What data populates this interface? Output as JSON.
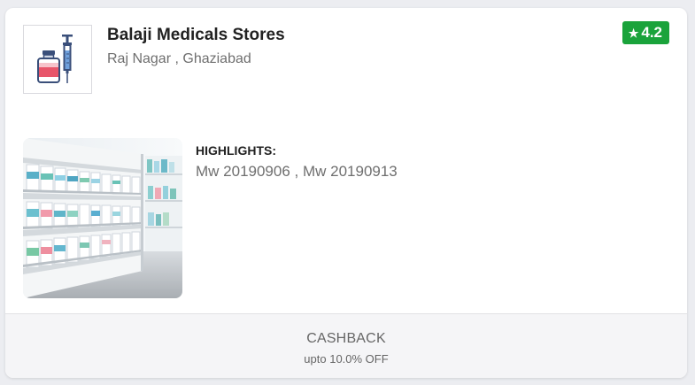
{
  "store": {
    "name": "Balaji Medicals Stores",
    "location": "Raj Nagar , Ghaziabad",
    "logo_icon": "medicine-vial-syringe-icon"
  },
  "rating": {
    "icon": "star-icon",
    "value": "4.2",
    "color": "#1aa33b"
  },
  "highlights": {
    "title": "HIGHLIGHTS:",
    "value": "Mw 20190906 , Mw 20190913"
  },
  "photo": {
    "subject": "pharmacy-shelves-image"
  },
  "cashback": {
    "title": "CASHBACK",
    "subtitle": "upto 10.0% OFF"
  }
}
